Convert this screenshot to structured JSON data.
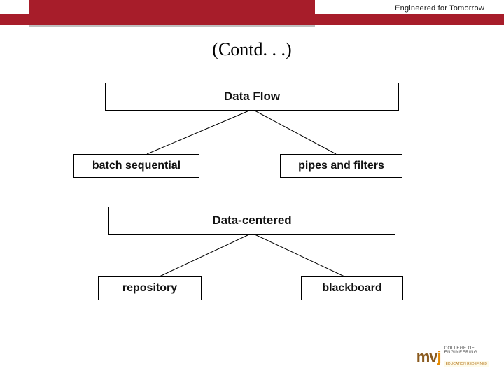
{
  "header": {
    "tagline": "Engineered for Tomorrow"
  },
  "title": "(Contd. . .)",
  "diagram1": {
    "root": "Data Flow",
    "left": "batch sequential",
    "right": "pipes and filters"
  },
  "diagram2": {
    "root": "Data-centered",
    "left": "repository",
    "right": "blackboard"
  },
  "logo": {
    "mark_prefix": "m",
    "mark_highlight": "v",
    "mark_suffix": "j",
    "text_line1": "COLLEGE OF",
    "text_line2": "ENGINEERING",
    "sub": "EDUCATION REDEFINED"
  },
  "colors": {
    "accent": "#a71d2a"
  }
}
